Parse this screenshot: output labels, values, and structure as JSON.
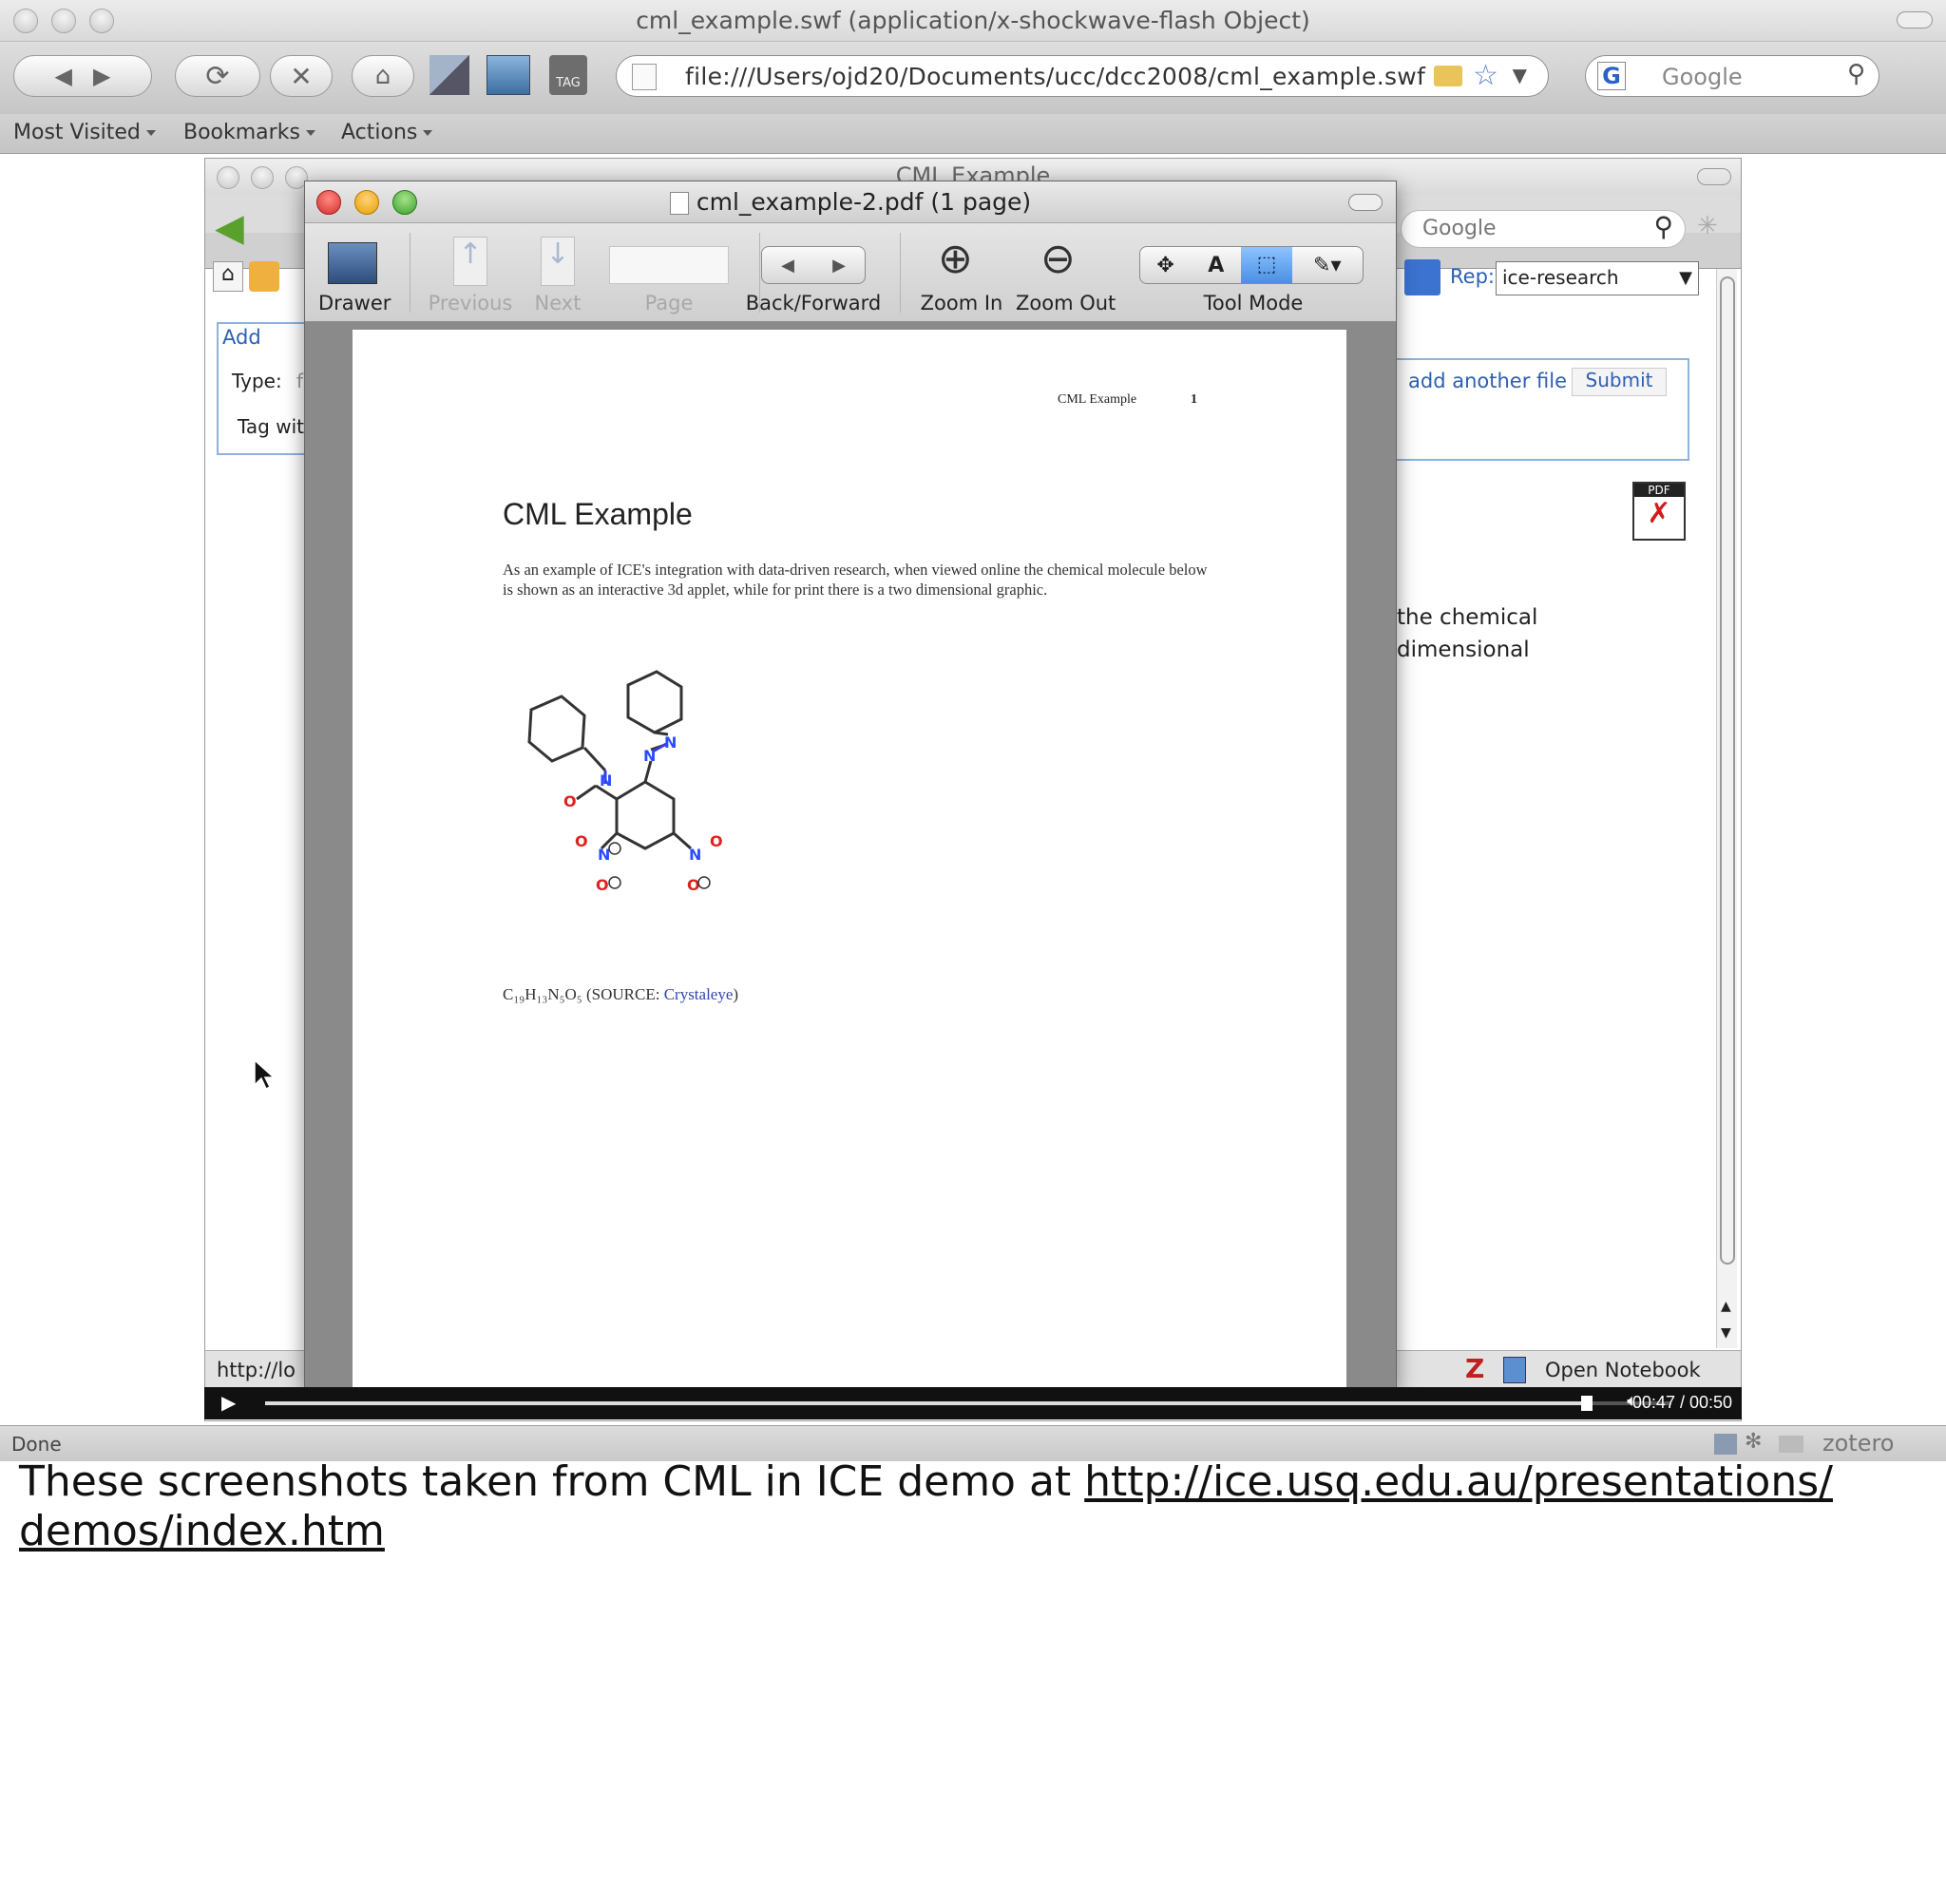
{
  "browser": {
    "window_title": "cml_example.swf (application/x-shockwave-flash Object)",
    "url": "file:///Users/ojd20/Documents/ucc/dcc2008/cml_example.swf",
    "search_placeholder": "Google",
    "bookmarks": [
      {
        "label": "Most Visited"
      },
      {
        "label": "Bookmarks"
      },
      {
        "label": "Actions"
      }
    ],
    "status": "Done",
    "zotero": "zotero",
    "tag_icon_label": "TAG"
  },
  "inner": {
    "window_title": "CML Example",
    "search_placeholder": "Google",
    "rep_label": "Rep:",
    "rep_value": "ice-research",
    "add_label": "Add",
    "type_label": "Type:",
    "type_value": "f",
    "tag_label": "Tag wit",
    "add_another_file": "add another file",
    "submit": "Submit",
    "body_text_1": "the chemical",
    "body_text_2": "dimensional",
    "status_url": "http://lo",
    "open_notebook": "Open Notebook",
    "zotero_z": "Z",
    "pdf_icon_label": "PDF"
  },
  "pdf": {
    "title": "cml_example-2.pdf (1 page)",
    "toolbar": {
      "drawer": "Drawer",
      "previous": "Previous",
      "next": "Next",
      "page": "Page",
      "back_forward": "Back/Forward",
      "zoom_in": "Zoom In",
      "zoom_out": "Zoom Out",
      "tool_mode": "Tool Mode",
      "text_tool": "A"
    },
    "page": {
      "header_title": "CML Example",
      "header_page": "1",
      "heading": "CML Example",
      "paragraph": "As an example of ICE's integration with data-driven research, when viewed online the chemical molecule below is shown as an interactive 3d applet, while for print there is a two dimensional graphic.",
      "formula_prefix": "C₁₉H₁₃N₅O₅ (SOURCE: ",
      "formula_link": "Crystaleye",
      "formula_suffix": ")",
      "atoms": {
        "N": "N",
        "O": "O"
      }
    }
  },
  "video": {
    "time": "00:47 / 00:50",
    "progress": 0.94
  },
  "caption": {
    "text": "These screenshots taken from CML in ICE demo at ",
    "link_line1": "http://ice.usq.edu.au/presentations/",
    "link_line2": "demos/index.htm"
  }
}
